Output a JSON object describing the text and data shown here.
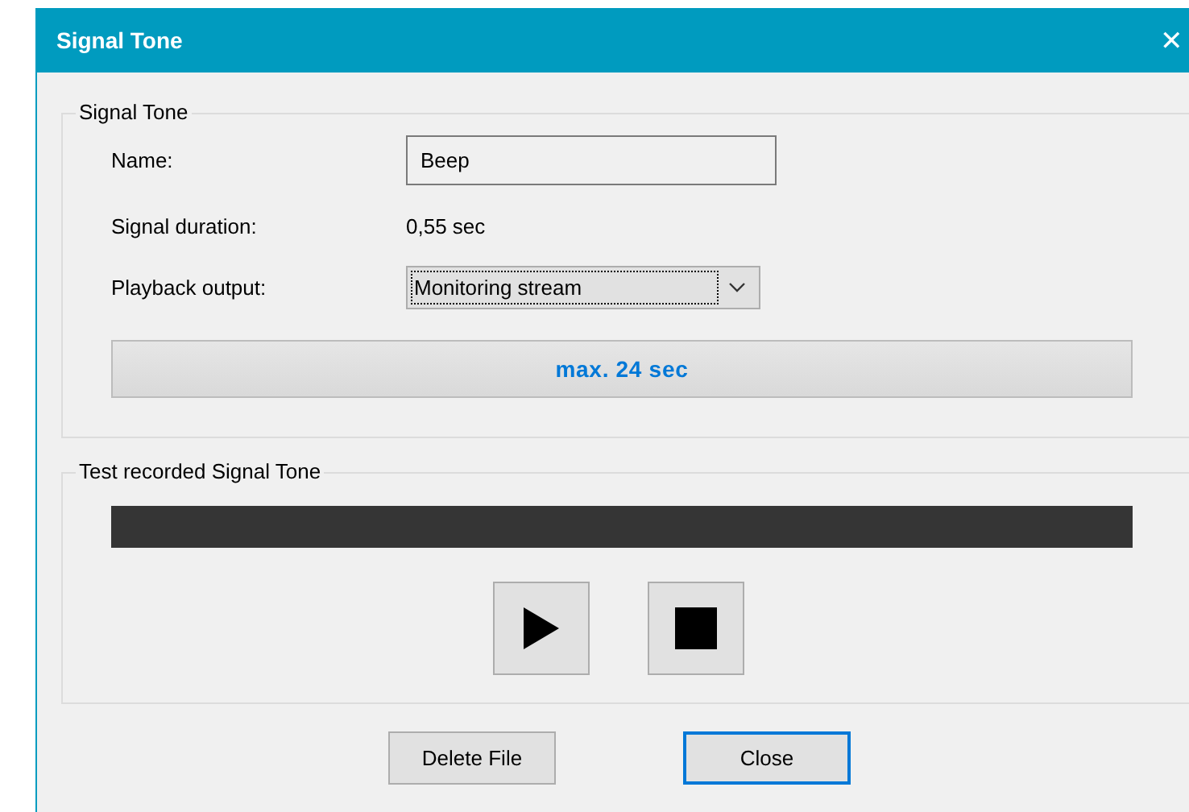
{
  "window": {
    "title": "Signal Tone",
    "close_glyph": "✕"
  },
  "signal_group": {
    "title": "Signal Tone",
    "name": {
      "label": "Name:",
      "value": "Beep"
    },
    "duration": {
      "label": "Signal duration:",
      "value": "0,55 sec"
    },
    "output": {
      "label": "Playback output:",
      "value": "Monitoring stream",
      "focused": true
    },
    "limit": "max. 24 sec"
  },
  "test_group": {
    "title": "Test recorded Signal Tone"
  },
  "buttons": [
    {
      "label": "Delete File",
      "default": false
    },
    {
      "label": "Close",
      "default": true
    }
  ]
}
